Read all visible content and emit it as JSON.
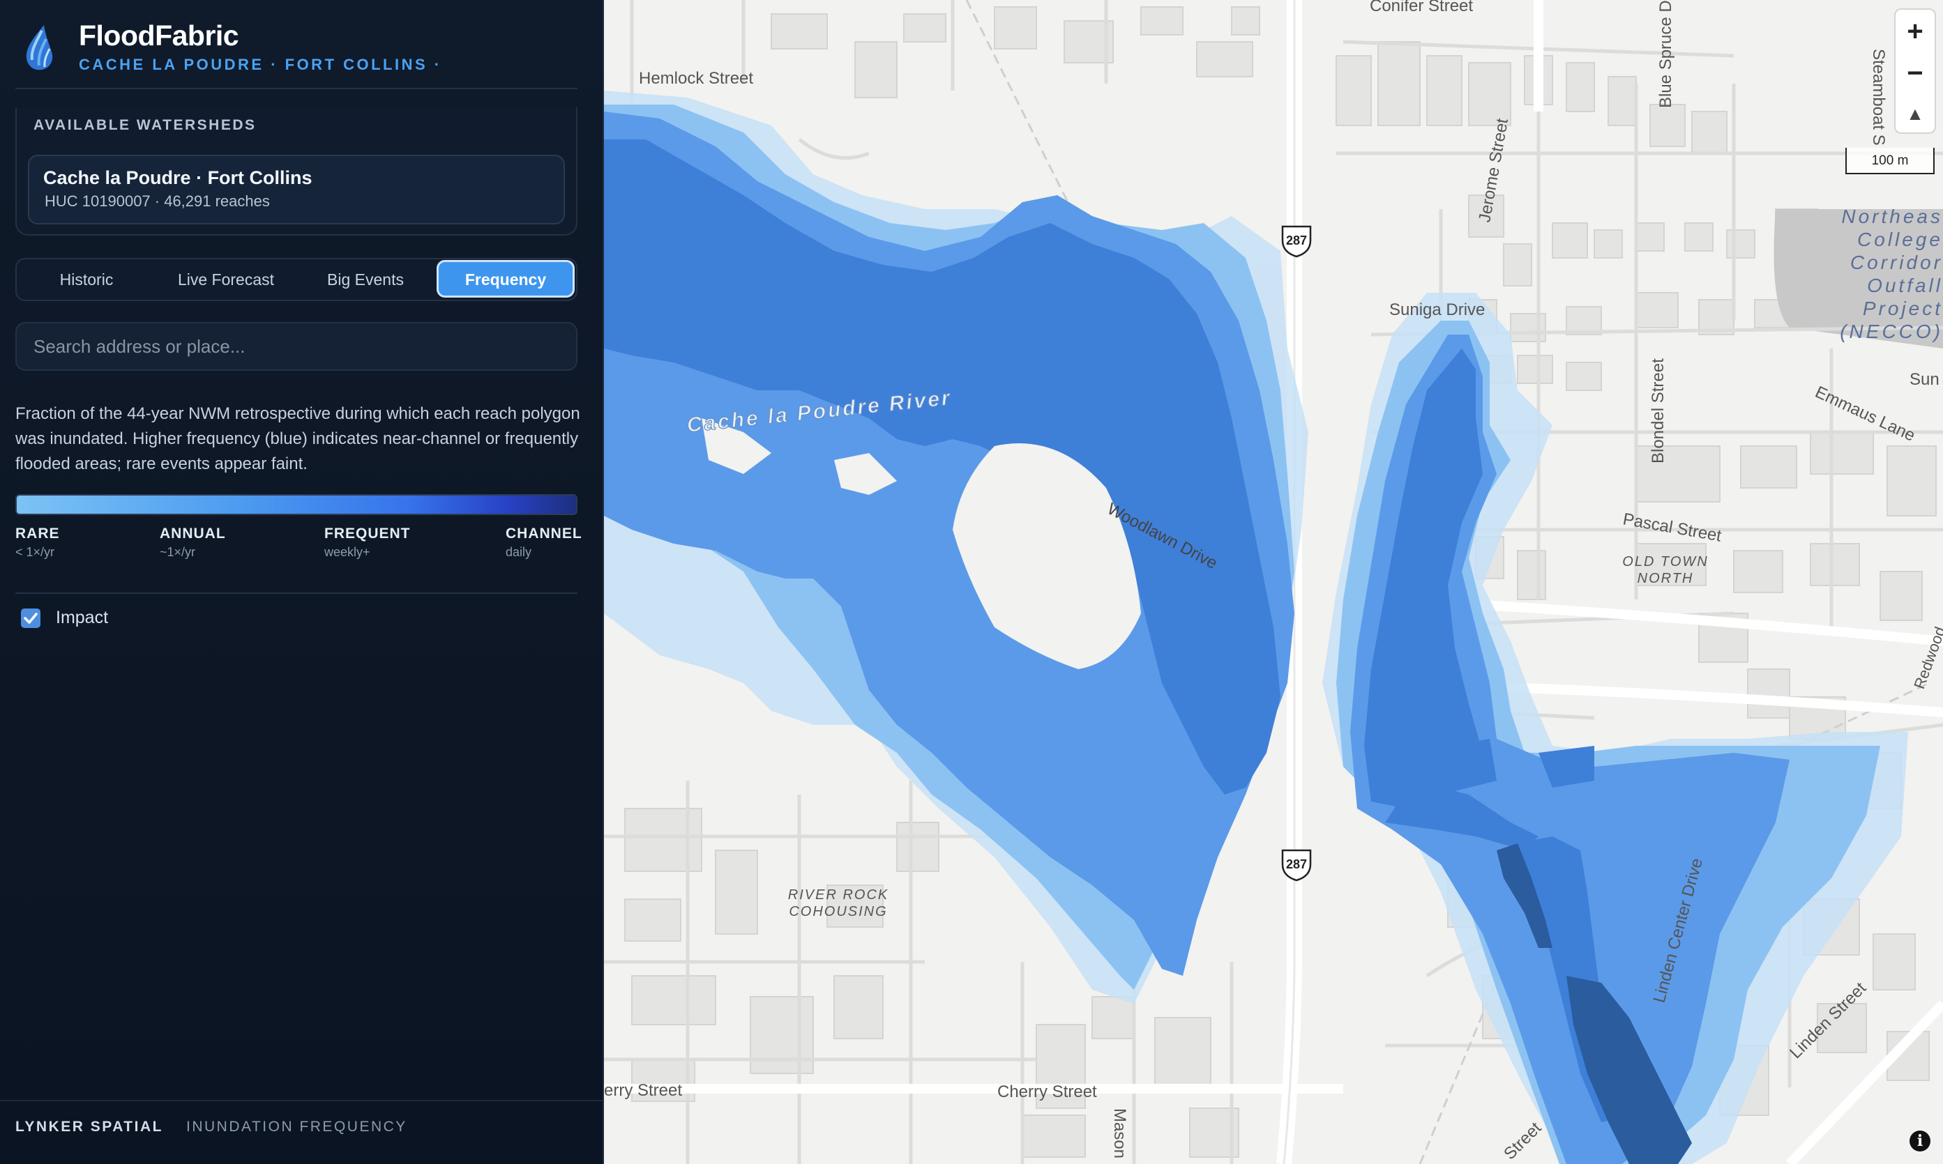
{
  "app": {
    "title": "FloodFabric",
    "subtitle": "CACHE LA POUDRE · FORT COLLINS ·"
  },
  "watersheds": {
    "section_title": "AVAILABLE WATERSHEDS",
    "items": [
      {
        "name": "Cache la Poudre · Fort Collins",
        "meta": "HUC 10190007 · 46,291 reaches"
      }
    ]
  },
  "tabs": [
    {
      "label": "Historic"
    },
    {
      "label": "Live Forecast"
    },
    {
      "label": "Big Events"
    },
    {
      "label": "Frequency",
      "active": true
    }
  ],
  "search": {
    "placeholder": "Search address or place..."
  },
  "description": "Fraction of the 44-year NWM retrospective during which each reach polygon was inundated. Higher frequency (blue) indicates near-channel or frequently flooded areas; rare events appear faint.",
  "legend": {
    "items": [
      {
        "label": "RARE",
        "sub": "< 1×/yr"
      },
      {
        "label": "ANNUAL",
        "sub": "~1×/yr"
      },
      {
        "label": "FREQUENT",
        "sub": "weekly+"
      },
      {
        "label": "CHANNEL",
        "sub": "daily"
      }
    ],
    "colors": [
      "#7cc3f5",
      "#4d9bf0",
      "#3773ea",
      "#1d2f7e"
    ]
  },
  "impact": {
    "label": "Impact",
    "checked": true
  },
  "footer": {
    "brand": "LYNKER SPATIAL",
    "product": "INUNDATION FREQUENCY"
  },
  "map": {
    "zoom_in": "+",
    "zoom_out": "−",
    "compass": "▲",
    "scale_label": "100 m",
    "info": "i",
    "route_shield": "287",
    "labels": {
      "conifer": "Conifer Street",
      "hemlock": "Hemlock Street",
      "blue_spruce": "Blue Spruce D",
      "steamboat": "Steamboat S",
      "jerome": "Jerome Street",
      "suniga": "Suniga Drive",
      "blondel": "Blondel Street",
      "emmaus": "Emmaus Lane",
      "sun": "Sun",
      "pascal": "Pascal Street",
      "old_town_north_1": "OLD TOWN",
      "old_town_north_2": "NORTH",
      "river": "Cache la Poudre River",
      "woodlawn": "Woodlawn Drive",
      "river_rock_1": "RIVER ROCK",
      "river_rock_2": "COHOUSING",
      "linden_center": "Linden Center Drive",
      "linden": "Linden Street",
      "redwood": "Redwood",
      "cherry_left": "erry Street",
      "cherry": "Cherry Street",
      "mason": "Mason",
      "street_br": "Street",
      "necco": [
        "Northeas",
        "College",
        "Corridor",
        "Outfall",
        "Project",
        "(NECCO)"
      ]
    },
    "flood_colors": {
      "rare": "#c7e1f7",
      "annual": "#8cc2f2",
      "frequent": "#5b9ae8",
      "very_frequent": "#3e7fd8",
      "channel": "#2a5c9e"
    }
  }
}
